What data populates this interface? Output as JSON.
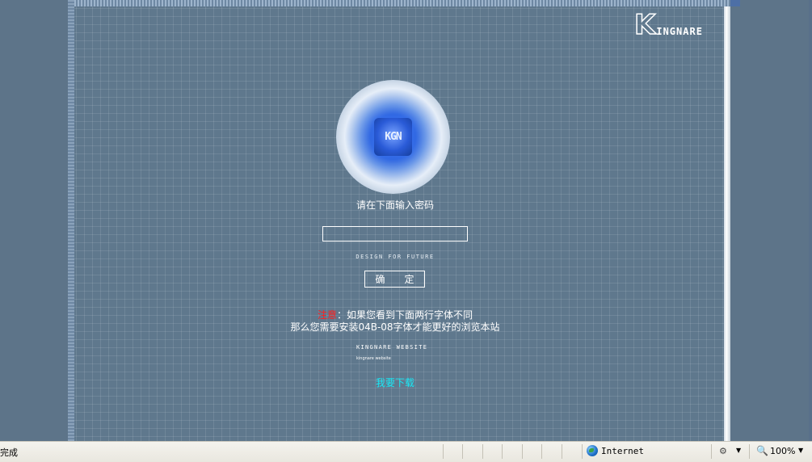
{
  "logo": {
    "initial": "K",
    "rest": "INGNARE"
  },
  "emblem": {
    "text": "KGN"
  },
  "form": {
    "prompt": "请在下面输入密码",
    "password_value": "",
    "tagline": "DESIGN FOR FUTURE",
    "submit_label": "确　　定"
  },
  "notice": {
    "label": "注意",
    "line1_rest": "：如果您看到下面两行字体不同",
    "line2": "那么您需要安装04B-08字体才能更好的浏览本站"
  },
  "font_samples": {
    "sample1": "KINGNARE WEBSITE",
    "sample2": "kingnare website"
  },
  "download_link": "我要下载",
  "statusbar": {
    "status": "完成",
    "zone": "Internet",
    "zoom": "100%"
  },
  "colors": {
    "background": "#5f788d",
    "notice_red": "#ff2020",
    "link_cyan": "#19e8f5"
  }
}
